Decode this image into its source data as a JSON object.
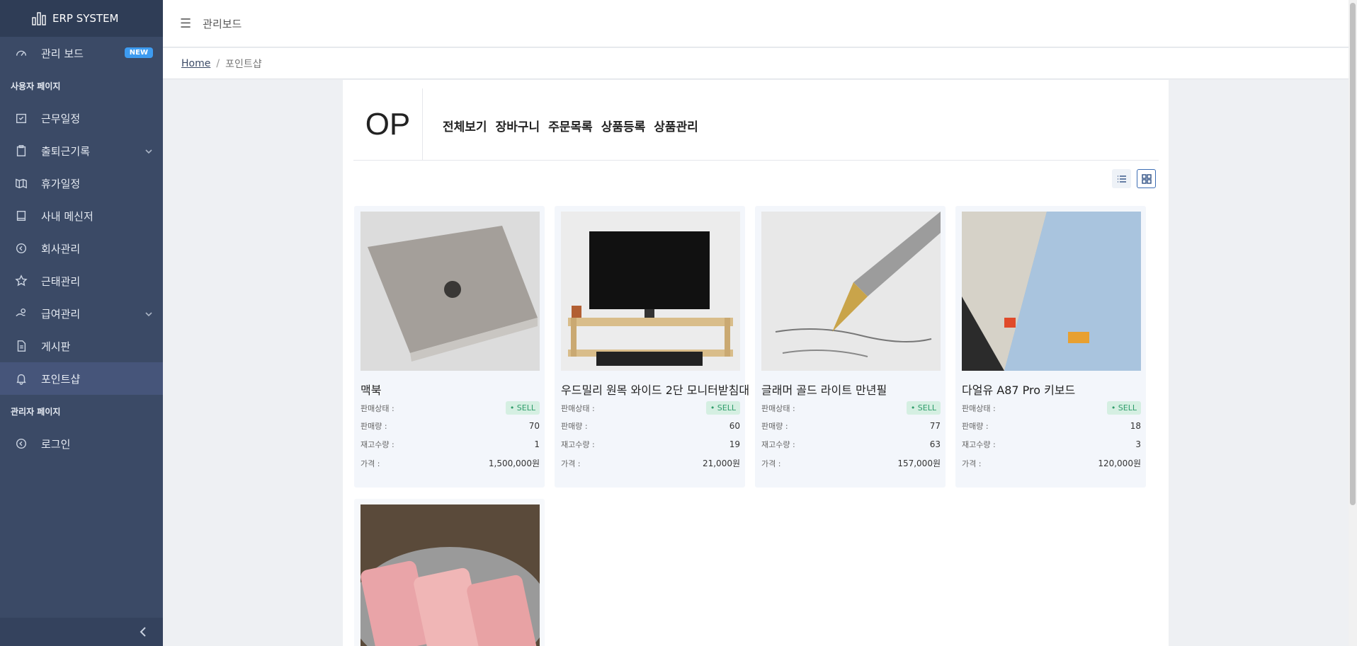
{
  "sidebar": {
    "brand": "ERP SYSTEM",
    "dashboard": {
      "label": "관리 보드",
      "badge": "NEW",
      "icon": "speedometer-icon"
    },
    "user_section": "사용자 페이지",
    "items": [
      {
        "label": "근무일정",
        "icon": "calendar-check-icon"
      },
      {
        "label": "출퇴근기록",
        "icon": "clipboard-icon",
        "has_submenu": true
      },
      {
        "label": "휴가일정",
        "icon": "map-icon"
      },
      {
        "label": "사내 메신저",
        "icon": "book-icon"
      },
      {
        "label": "회사관리",
        "icon": "circle-arrow-icon"
      },
      {
        "label": "근태관리",
        "icon": "star-icon"
      },
      {
        "label": "급여관리",
        "icon": "hand-coin-icon",
        "has_submenu": true
      },
      {
        "label": "게시판",
        "icon": "document-icon"
      },
      {
        "label": "포인트샵",
        "icon": "bell-icon",
        "active": true
      }
    ],
    "admin_section": "관리자 페이지",
    "admin_items": [
      {
        "label": "로그인",
        "icon": "circle-arrow-icon"
      }
    ]
  },
  "topbar": {
    "title": "관리보드"
  },
  "breadcrumb": {
    "home": "Home",
    "current": "포인트샵"
  },
  "shop": {
    "logo": "OP",
    "nav": [
      "전체보기",
      "장바구니",
      "주문목록",
      "상품등록",
      "상품관리"
    ]
  },
  "labels": {
    "status": "판매상태 :",
    "sold": "판매량 :",
    "stock": "재고수량 :",
    "price": "가격 :"
  },
  "products": [
    {
      "name": "맥북",
      "status": "• SELL",
      "sold": "70",
      "stock": "1",
      "price": "1,500,000원"
    },
    {
      "name": "우드밀리 원목 와이드 2단 모니터받침대",
      "status": "• SELL",
      "sold": "60",
      "stock": "19",
      "price": "21,000원"
    },
    {
      "name": "글래머 골드 라이트 만년필",
      "status": "• SELL",
      "sold": "77",
      "stock": "63",
      "price": "157,000원"
    },
    {
      "name": "다얼유 A87 Pro 키보드",
      "status": "• SELL",
      "sold": "18",
      "stock": "3",
      "price": "120,000원"
    }
  ],
  "colors": {
    "sidebar": "#3b4a66",
    "accent": "#3d9bf0",
    "sell": "#2e9c6a"
  }
}
